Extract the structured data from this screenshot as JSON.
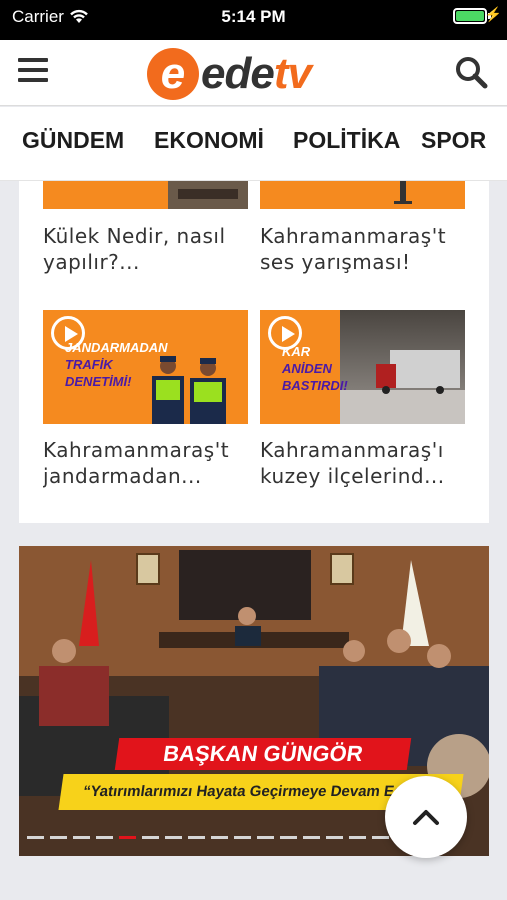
{
  "status_bar": {
    "carrier": "Carrier",
    "time": "5:14 PM",
    "battery_level": 1.0,
    "icons": [
      "wifi-icon",
      "battery-icon",
      "charging-bolt-icon"
    ]
  },
  "header": {
    "logo_mark": "e",
    "logo_text_main": "ede",
    "logo_text_accent": "tv",
    "menu_icon": "hamburger-menu-icon",
    "search_icon": "search-icon",
    "brand_color": "#f26b1d"
  },
  "categories": [
    {
      "label": "GÜNDEM"
    },
    {
      "label": "EKONOMİ"
    },
    {
      "label": "POLİTİKA"
    },
    {
      "label": "SPOR"
    }
  ],
  "news": [
    {
      "title_line1": "Külek Nedir, nasıl",
      "title_line2": "yapılır?..."
    },
    {
      "title_line1": "Kahramanmaraş't",
      "title_line2": "ses yarışması!"
    },
    {
      "title_line1": "Kahramanmaraş't",
      "title_line2": "jandarmadan...",
      "caption": [
        "JANDARMADAN",
        "TRAFİK",
        "DENETİMİ!"
      ]
    },
    {
      "title_line1": "Kahramanmaraş'ı",
      "title_line2": "kuzey ilçelerind...",
      "caption": [
        "KAR",
        "ANİDEN",
        "BASTIRDI!"
      ]
    }
  ],
  "slider": {
    "headline": "BAŞKAN GÜNGÖR",
    "subheadline": "“Yatırımlarımızı Hayata Geçirmeye Devam Ediyo",
    "page_count": 18,
    "active_page": 4,
    "accent_color": "#e1141b",
    "sub_color": "#f7d21a"
  },
  "scroll_top_icon": "chevron-up-icon"
}
